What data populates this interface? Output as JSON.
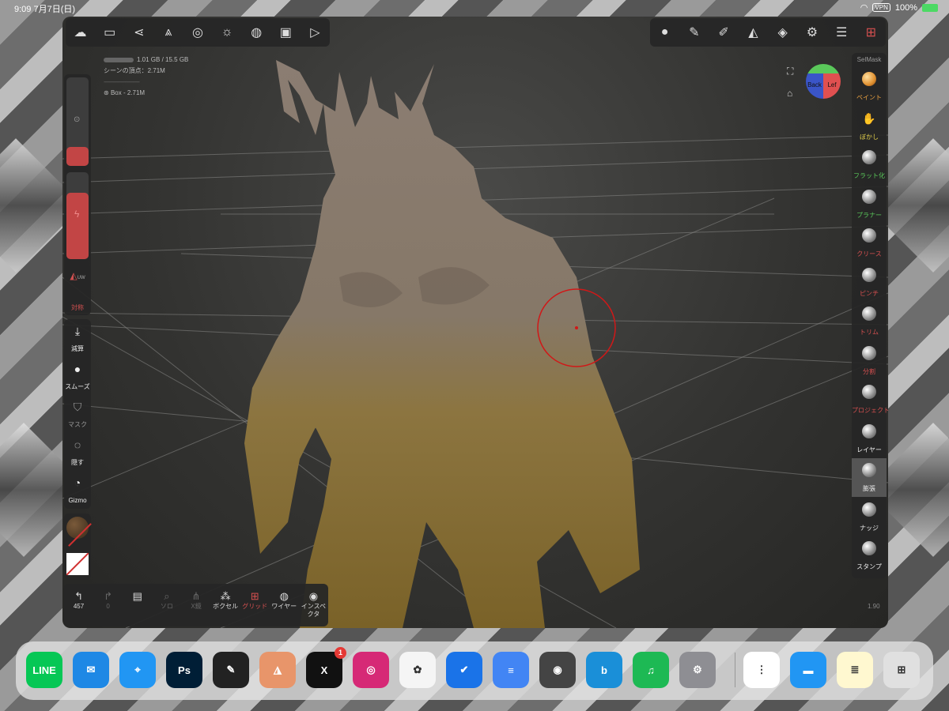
{
  "status_bar": {
    "time": "9:09",
    "date": "7月7日(日)",
    "vpn": "VPN",
    "battery": "100%"
  },
  "top_left_tools": [
    {
      "name": "cloud-icon",
      "glyph": "☁"
    },
    {
      "name": "folder-icon",
      "glyph": "▭"
    },
    {
      "name": "share-icon",
      "glyph": "⋖"
    },
    {
      "name": "scene-icon",
      "glyph": "⩓"
    },
    {
      "name": "mesh-icon",
      "glyph": "◎"
    },
    {
      "name": "light-icon",
      "glyph": "☼"
    },
    {
      "name": "material-icon",
      "glyph": "◍"
    },
    {
      "name": "image-icon",
      "glyph": "▣"
    },
    {
      "name": "camera-icon",
      "glyph": "▷"
    }
  ],
  "top_right_tools": [
    {
      "name": "matcap-icon",
      "glyph": "●"
    },
    {
      "name": "brush-icon",
      "glyph": "✎"
    },
    {
      "name": "paint-tool-icon",
      "glyph": "✐"
    },
    {
      "name": "symmetry-icon",
      "glyph": "◭"
    },
    {
      "name": "layers-icon",
      "glyph": "◈"
    },
    {
      "name": "settings-icon",
      "glyph": "⚙"
    },
    {
      "name": "sliders-icon",
      "glyph": "☰"
    },
    {
      "name": "fence-icon",
      "glyph": "⊞"
    }
  ],
  "info": {
    "memory": "1.01 GB / 15.5 GB",
    "scene_vertices": "シーンの頂点：2.71M",
    "separator": "---------------------------",
    "object": "Box - 2.71M"
  },
  "left_panel": {
    "sym_label": "対称",
    "sym_badge": "UW"
  },
  "left_tools": [
    {
      "name": "subtract",
      "label": "減算",
      "glyph": "⤓",
      "dim": false
    },
    {
      "name": "smooth",
      "label": "スムーズ",
      "glyph": "●",
      "dim": false
    },
    {
      "name": "mask",
      "label": "マスク",
      "glyph": "⛉",
      "dim": true
    },
    {
      "name": "hide",
      "label": "隠す",
      "glyph": "◌",
      "dim": false
    },
    {
      "name": "gizmo",
      "label": "Gizmo",
      "glyph": "◔",
      "dim": false
    }
  ],
  "bottom_tools": [
    {
      "name": "undo",
      "label": "457",
      "glyph": "↰",
      "state": "normal"
    },
    {
      "name": "redo",
      "label": "0",
      "glyph": "↱",
      "state": "dim"
    },
    {
      "name": "object",
      "label": "",
      "glyph": "▤",
      "state": "normal"
    },
    {
      "name": "solo",
      "label": "ソロ",
      "glyph": "⌕",
      "state": "dim"
    },
    {
      "name": "x-mirror",
      "label": "X鏡",
      "glyph": "⋔",
      "state": "dim"
    },
    {
      "name": "voxel",
      "label": "ボクセル",
      "glyph": "⁂",
      "state": "normal"
    },
    {
      "name": "grid",
      "label": "グリッド",
      "glyph": "⊞",
      "state": "red"
    },
    {
      "name": "wire",
      "label": "ワイヤー",
      "glyph": "◍",
      "state": "normal"
    },
    {
      "name": "inspector",
      "label": "インスペクタ",
      "glyph": "◉",
      "state": "normal"
    }
  ],
  "brush_panel": {
    "title": "SelMask"
  },
  "brushes": [
    {
      "name": "paint",
      "label": "ペイント",
      "style": "orange",
      "active": false
    },
    {
      "name": "blur",
      "label": "ぼかし",
      "style": "yellow",
      "active": false
    },
    {
      "name": "flatten",
      "label": "フラット化",
      "style": "green",
      "active": false
    },
    {
      "name": "planar",
      "label": "プラナー",
      "style": "green",
      "active": false
    },
    {
      "name": "crease",
      "label": "クリース",
      "style": "red",
      "active": false
    },
    {
      "name": "pinch",
      "label": "ピンチ",
      "style": "red",
      "active": false
    },
    {
      "name": "trim",
      "label": "トリム",
      "style": "red",
      "active": false
    },
    {
      "name": "split",
      "label": "分割",
      "style": "red",
      "active": false
    },
    {
      "name": "project",
      "label": "プロジェクト",
      "style": "red",
      "active": false
    },
    {
      "name": "layer",
      "label": "レイヤー",
      "style": "white",
      "active": false
    },
    {
      "name": "inflate",
      "label": "膨張",
      "style": "white",
      "active": true
    },
    {
      "name": "nudge",
      "label": "ナッジ",
      "style": "white",
      "active": false
    },
    {
      "name": "stamp",
      "label": "スタンプ",
      "style": "white",
      "active": false
    }
  ],
  "nav_cube": {
    "back": "Back",
    "left": "Lef"
  },
  "version": "1.90",
  "dock": {
    "apps": [
      {
        "name": "line",
        "label": "LINE",
        "color": "#06c755",
        "badge": ""
      },
      {
        "name": "mail",
        "label": "✉",
        "color": "#1e88e5",
        "badge": ""
      },
      {
        "name": "safari",
        "label": "⌖",
        "color": "#2196f3",
        "badge": ""
      },
      {
        "name": "photoshop",
        "label": "Ps",
        "color": "#001e36",
        "badge": ""
      },
      {
        "name": "procreate",
        "label": "✎",
        "color": "#222222",
        "badge": ""
      },
      {
        "name": "dunes",
        "label": "◮",
        "color": "#e8956a",
        "badge": ""
      },
      {
        "name": "x",
        "label": "X",
        "color": "#111111",
        "badge": "1"
      },
      {
        "name": "instagram",
        "label": "◎",
        "color": "#d62976",
        "badge": ""
      },
      {
        "name": "photos",
        "label": "✿",
        "color": "#f5f5f5",
        "badge": ""
      },
      {
        "name": "tasks",
        "label": "✔",
        "color": "#1a73e8",
        "badge": ""
      },
      {
        "name": "docs",
        "label": "≡",
        "color": "#4285f4",
        "badge": ""
      },
      {
        "name": "camera",
        "label": "◉",
        "color": "#444444",
        "badge": ""
      },
      {
        "name": "bing",
        "label": "b",
        "color": "#1a8fd8",
        "badge": ""
      },
      {
        "name": "music",
        "label": "♫",
        "color": "#1db954",
        "badge": ""
      },
      {
        "name": "settings",
        "label": "⚙",
        "color": "#8e8e93",
        "badge": ""
      },
      {
        "name": "reminders",
        "label": "⋮",
        "color": "#ffffff",
        "badge": ""
      },
      {
        "name": "files",
        "label": "▬",
        "color": "#2196f3",
        "badge": ""
      },
      {
        "name": "notes",
        "label": "≣",
        "color": "#fff8d0",
        "badge": ""
      },
      {
        "name": "app-library",
        "label": "⊞",
        "color": "#e0e0e0",
        "badge": ""
      }
    ]
  }
}
